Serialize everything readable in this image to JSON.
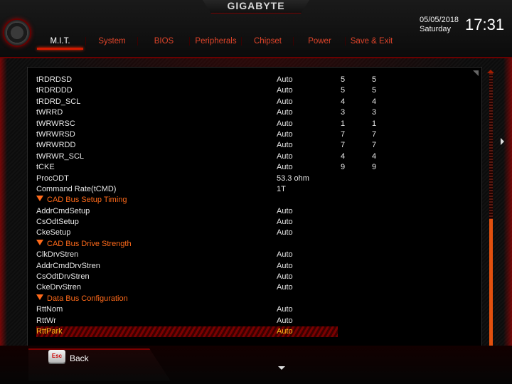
{
  "brand": "GIGABYTE",
  "clock": {
    "date": "05/05/2018",
    "day": "Saturday",
    "time": "17:31"
  },
  "tabs": [
    {
      "label": "M.I.T.",
      "active": true
    },
    {
      "label": "System",
      "active": false
    },
    {
      "label": "BIOS",
      "active": false
    },
    {
      "label": "Peripherals",
      "active": false
    },
    {
      "label": "Chipset",
      "active": false
    },
    {
      "label": "Power",
      "active": false
    },
    {
      "label": "Save & Exit",
      "active": false
    }
  ],
  "rows": [
    {
      "name": "tRDRDSD",
      "value": "Auto",
      "c1": "5",
      "c2": "5"
    },
    {
      "name": "tRDRDDD",
      "value": "Auto",
      "c1": "5",
      "c2": "5"
    },
    {
      "name": "tRDRD_SCL",
      "value": "Auto",
      "c1": "4",
      "c2": "4"
    },
    {
      "name": "tWRRD",
      "value": "Auto",
      "c1": "3",
      "c2": "3"
    },
    {
      "name": "tWRWRSC",
      "value": "Auto",
      "c1": "1",
      "c2": "1"
    },
    {
      "name": "tWRWRSD",
      "value": "Auto",
      "c1": "7",
      "c2": "7"
    },
    {
      "name": "tWRWRDD",
      "value": "Auto",
      "c1": "7",
      "c2": "7"
    },
    {
      "name": "tWRWR_SCL",
      "value": "Auto",
      "c1": "4",
      "c2": "4"
    },
    {
      "name": "tCKE",
      "value": "Auto",
      "c1": "9",
      "c2": "9"
    },
    {
      "name": "ProcODT",
      "value": "53.3 ohm",
      "c1": "",
      "c2": ""
    },
    {
      "name": "Command Rate(tCMD)",
      "value": "1T",
      "c1": "",
      "c2": ""
    },
    {
      "name": "CAD Bus Setup Timing",
      "section": true
    },
    {
      "name": "AddrCmdSetup",
      "value": "Auto",
      "c1": "",
      "c2": ""
    },
    {
      "name": "CsOdtSetup",
      "value": "Auto",
      "c1": "",
      "c2": ""
    },
    {
      "name": "CkeSetup",
      "value": "Auto",
      "c1": "",
      "c2": ""
    },
    {
      "name": "CAD Bus Drive Strength",
      "section": true
    },
    {
      "name": "ClkDrvStren",
      "value": "Auto",
      "c1": "",
      "c2": ""
    },
    {
      "name": "AddrCmdDrvStren",
      "value": "Auto",
      "c1": "",
      "c2": ""
    },
    {
      "name": "CsOdtDrvStren",
      "value": "Auto",
      "c1": "",
      "c2": ""
    },
    {
      "name": "CkeDrvStren",
      "value": "Auto",
      "c1": "",
      "c2": ""
    },
    {
      "name": "Data Bus Configuration",
      "section": true
    },
    {
      "name": "RttNom",
      "value": "Auto",
      "c1": "",
      "c2": ""
    },
    {
      "name": "RttWr",
      "value": "Auto",
      "c1": "",
      "c2": ""
    },
    {
      "name": "RttPark",
      "value": "Auto",
      "c1": "",
      "c2": "",
      "selected": true
    }
  ],
  "footer": {
    "esc_key": "Esc",
    "back_label": "Back"
  },
  "scroll": {
    "position_fraction": 0.53
  },
  "colors": {
    "accent": "#d31a00",
    "section": "#ff6a1a",
    "selected_text": "#ffc21a",
    "tab_inactive": "#e0442a"
  },
  "icons": {
    "logo": "gigabyte-gear-logo-icon",
    "scroll_up": "scroll-up-arrow-icon",
    "page_down": "page-down-arrow-icon",
    "page_right": "page-right-arrow-icon"
  }
}
